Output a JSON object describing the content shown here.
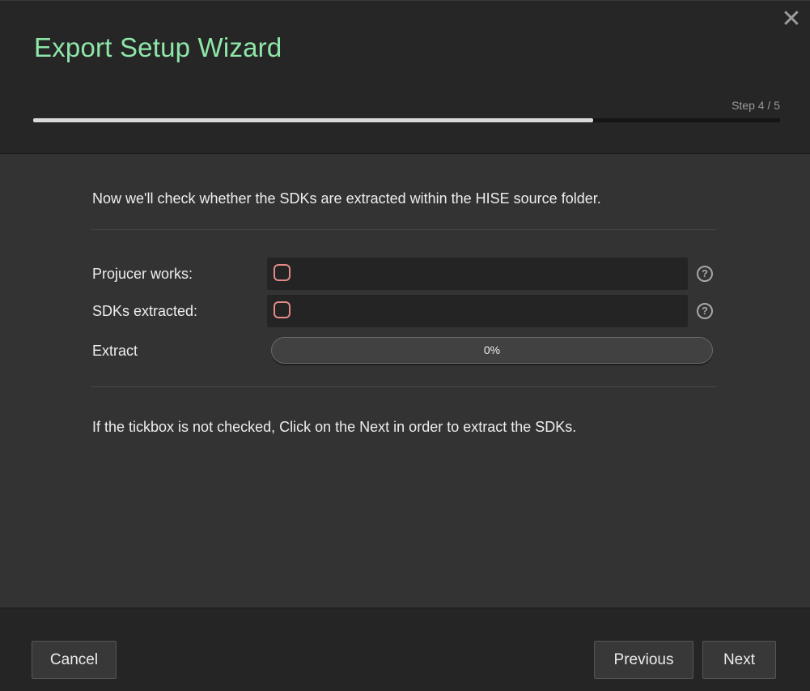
{
  "window": {
    "title": "Export Setup Wizard",
    "close_icon": "close-icon",
    "step_text": "Step 4 / 5",
    "step_progress": 0.75
  },
  "content": {
    "intro": "Now we'll check whether the SDKs are extracted within the HISE source folder.",
    "rows": [
      {
        "label": "Projucer works:",
        "checked": false,
        "help_glyph": "?"
      },
      {
        "label": "SDKs extracted:",
        "checked": false,
        "help_glyph": "?"
      }
    ],
    "extract": {
      "label": "Extract",
      "progress_text": "0%",
      "progress": 0
    },
    "note": "If the tickbox is not checked, Click on the Next in order to extract the SDKs."
  },
  "footer": {
    "cancel_label": "Cancel",
    "previous_label": "Previous",
    "next_label": "Next"
  },
  "colors": {
    "title": "#8ee6a8",
    "checkbox_border": "#e38a86"
  }
}
